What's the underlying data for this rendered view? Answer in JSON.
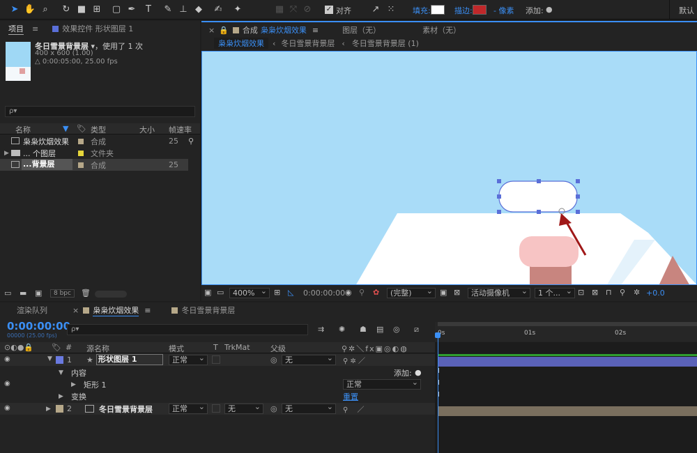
{
  "toolbar": {
    "align_label": "对齐",
    "fill_label": "填充:",
    "stroke_label": "描边:",
    "stroke_unit": "- 像素",
    "add_label": "添加:",
    "workspace_label": "默认",
    "colors": {
      "accent": "#3b8ff5",
      "fill": "#ffffff",
      "stroke": "#c0282a"
    }
  },
  "project": {
    "tab_project": "项目",
    "tab_effects": "效果控件 形状图层 1",
    "item_name": "冬日雪景背景层",
    "used_text": "▾，使用了 1 次",
    "dimensions": "400 x 600 (1.00)",
    "duration": "△ 0:00:05:00, 25.00 fps",
    "search_placeholder": "ρ▾",
    "columns": {
      "name": "名称",
      "type": "类型",
      "size": "大小",
      "fps": "帧速率"
    },
    "items": [
      {
        "name": "枭枭炊烟效果",
        "type": "合成",
        "fps": "25",
        "color": "#b6a889"
      },
      {
        "name": "... 个图层",
        "type": "文件夹",
        "fps": "",
        "color": "#e6d63b"
      },
      {
        "name": "...背景层",
        "type": "合成",
        "fps": "25",
        "color": "#b6a889"
      }
    ],
    "bpc": "8 bpc"
  },
  "composition": {
    "tab_label": "合成",
    "tab_name": "枭枭炊烟效果",
    "layer_tab": "图层（无）",
    "footage_tab": "素材（无）",
    "breadcrumbs": [
      "枭枭炊烟效果",
      "冬日雪景背景层",
      "冬日雪景背景层 (1)"
    ],
    "zoom": "400%",
    "timecode": "0:00:00:00",
    "resolution": "(完整)",
    "camera": "活动摄像机",
    "views": "1 个...",
    "exposure": "+0.0"
  },
  "timeline": {
    "render_tab": "渲染队列",
    "comp_tab": "枭枭炊烟效果",
    "bg_tab": "冬日雪景背景层",
    "current_time": "0:00:00:00",
    "frame_info": "00000 (25.00 fps)",
    "search_placeholder": "ρ▾",
    "columns": {
      "hash": "#",
      "source": "源名称",
      "mode": "模式",
      "t": "T",
      "trkmat": "TrkMat",
      "parent": "父级"
    },
    "ruler": [
      "0s",
      "01s",
      "02s"
    ],
    "layers": [
      {
        "num": "1",
        "name": "形状图层 1",
        "mode": "正常",
        "parent": "无",
        "color": "#6a7ae0"
      },
      {
        "num": "2",
        "name": "冬日雪景背景层",
        "mode": "正常",
        "trkmat": "无",
        "parent": "无",
        "color": "#b6a889"
      }
    ],
    "content_label": "内容",
    "add_label": "添加:",
    "rect_label": "矩形 1",
    "rect_mode": "正常",
    "transform_label": "变换",
    "reset_label": "重置"
  }
}
